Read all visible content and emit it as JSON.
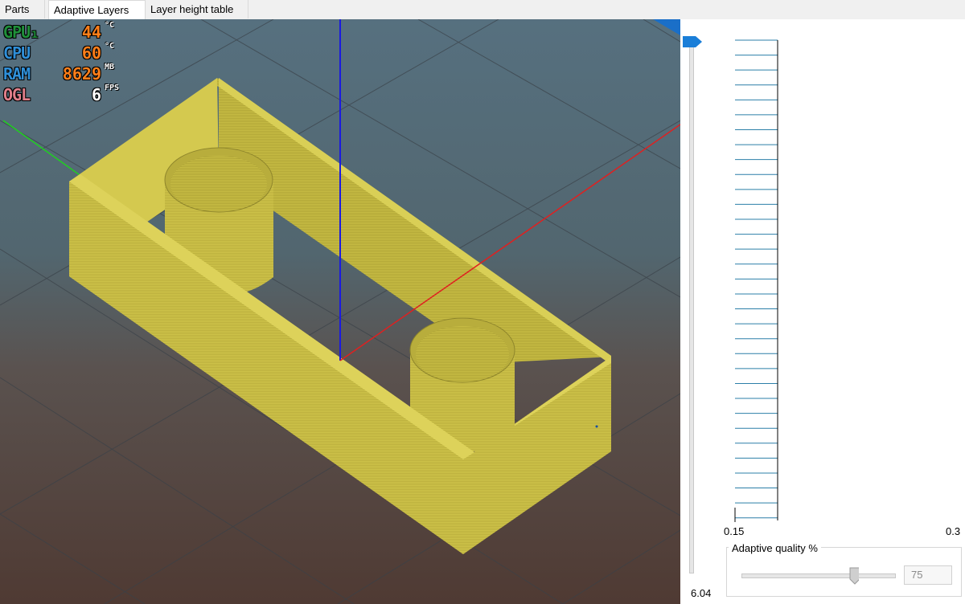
{
  "tabs": [
    {
      "label": "Parts"
    },
    {
      "label": "Adaptive Layers",
      "active": true
    },
    {
      "label": "Layer height table"
    }
  ],
  "hud": {
    "rows": [
      {
        "label": "GPU₁",
        "value": "44",
        "unit": "°C",
        "label_color": "#1f8f3a",
        "value_color": "#ff7f1a"
      },
      {
        "label": "CPU",
        "value": "60",
        "unit": "°C",
        "label_color": "#2f8fd8",
        "value_color": "#ff7f1a"
      },
      {
        "label": "RAM",
        "value": "8629",
        "unit": "MB",
        "label_color": "#2f8fd8",
        "value_color": "#ff7f1a"
      },
      {
        "label": "OGL",
        "value": "6",
        "unit": "FPS",
        "label_color": "#e07f8a",
        "value_color": "#ffffff"
      }
    ]
  },
  "layer_chart": {
    "x_min_label": "0.15",
    "x_max_label": "0.3",
    "line_count": 33,
    "line_color": "#2b7fa8"
  },
  "height_slider": {
    "value_label": "6.04",
    "handle_color": "#1a7ed8"
  },
  "adaptive_quality": {
    "title": "Adaptive quality %",
    "value": "75",
    "slider_fraction": 0.75
  },
  "colors": {
    "model": "#cfc44a",
    "background_top": "#56707f",
    "background_bottom": "#503a33",
    "axis_x": "#e02020",
    "axis_y": "#20d020",
    "axis_z": "#1a1ae0"
  }
}
